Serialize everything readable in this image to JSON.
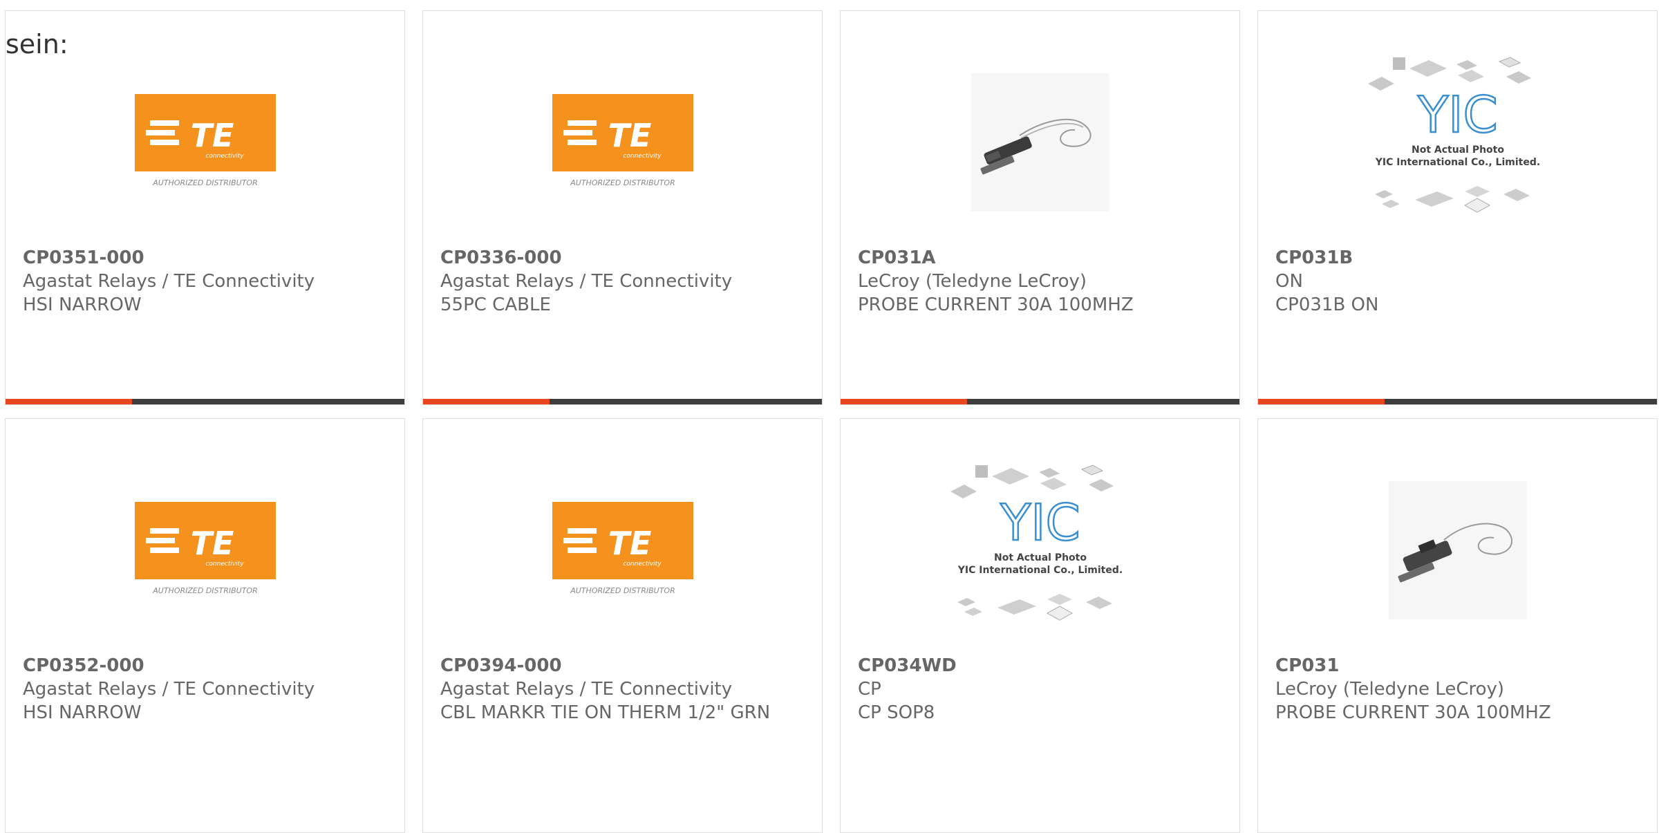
{
  "page": {
    "intro_text": "sein:"
  },
  "colors": {
    "accent": "#e8461e",
    "bar_dark": "#3d3d3d",
    "te_orange": "#f5921e",
    "yic_blue": "#3a8fd0"
  },
  "products": [
    {
      "part_number": "CP0351-000",
      "manufacturer": "Agastat Relays / TE Connectivity",
      "description": "HSI NARROW",
      "image": "te-logo"
    },
    {
      "part_number": "CP0336-000",
      "manufacturer": "Agastat Relays / TE Connectivity",
      "description": "55PC CABLE",
      "image": "te-logo"
    },
    {
      "part_number": "CP031A",
      "manufacturer": "LeCroy (Teledyne LeCroy)",
      "description": "PROBE CURRENT 30A 100MHZ",
      "image": "current-probe-photo"
    },
    {
      "part_number": "CP031B",
      "manufacturer": "ON",
      "description": "CP031B ON",
      "image": "yic-placeholder"
    },
    {
      "part_number": "CP0352-000",
      "manufacturer": "Agastat Relays / TE Connectivity",
      "description": "HSI NARROW",
      "image": "te-logo"
    },
    {
      "part_number": "CP0394-000",
      "manufacturer": "Agastat Relays / TE Connectivity",
      "description": "CBL MARKR TIE ON THERM 1/2\" GRN",
      "image": "te-logo"
    },
    {
      "part_number": "CP034WD",
      "manufacturer": "CP",
      "description": "CP SOP8",
      "image": "yic-placeholder"
    },
    {
      "part_number": "CP031",
      "manufacturer": "LeCroy (Teledyne LeCroy)",
      "description": "PROBE CURRENT 30A 100MHZ",
      "image": "current-probe-photo"
    }
  ],
  "logos": {
    "te": {
      "wordmark": "TE",
      "tagline": "connectivity",
      "caption": "AUTHORIZED DISTRIBUTOR"
    },
    "yic": {
      "mark": "YIC",
      "line1": "Not Actual Photo",
      "line2": "YIC International Co., Limited."
    }
  }
}
